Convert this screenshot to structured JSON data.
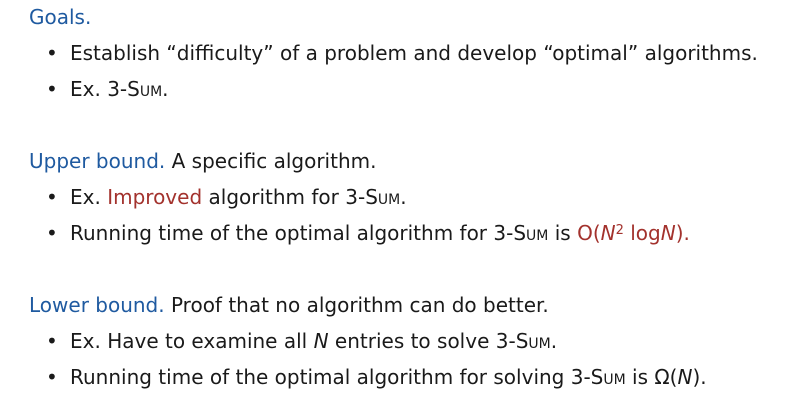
{
  "goals": {
    "term": "Goals.",
    "bullets": [
      "Establish “difficulty” of a problem and develop “optimal” algorithms.",
      "Ex. 3-SUM."
    ]
  },
  "upper": {
    "term": "Upper bound.",
    "text": "A specific algorithm.",
    "b1_pre": "Ex.",
    "b1_accent": "Improved",
    "b1_post": "algorithm for 3-SUM.",
    "b2_pre": "Running time of the optimal algorithm for 3-SUM is",
    "b2_O": "O(",
    "b2_N1": "N",
    "b2_exp": "2",
    "b2_log": " log",
    "b2_N2": "N",
    "b2_close": ")."
  },
  "lower": {
    "term": "Lower bound.",
    "text": "Proof that no algorithm can do better.",
    "b1_pre": "Ex. Have to examine all",
    "b1_N": "N",
    "b1_post": "entries to solve 3-SUM.",
    "b2_pre": "Running time of the optimal algorithm for solving 3-SUM is Ω(",
    "b2_N": "N",
    "b2_post": ")."
  },
  "bullet_char": "•"
}
